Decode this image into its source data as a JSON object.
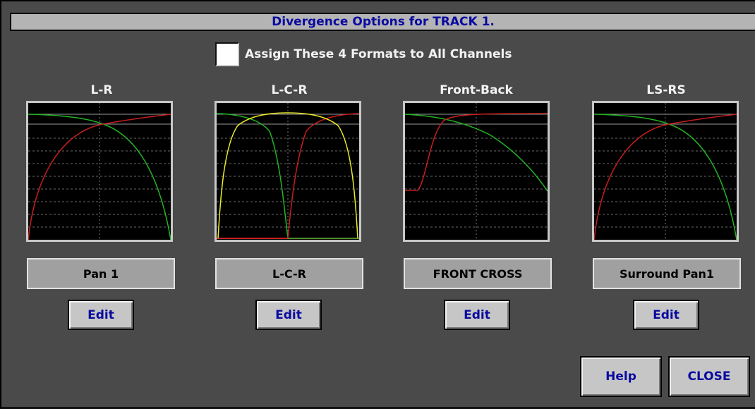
{
  "dialog": {
    "title": "Divergence Options for TRACK 1.",
    "assign_label": "Assign These 4 Formats to All Channels",
    "assign_checked": false
  },
  "panels": [
    {
      "title": "L-R",
      "format": "Pan 1",
      "edit_label": "Edit"
    },
    {
      "title": "L-C-R",
      "format": "L-C-R",
      "edit_label": "Edit"
    },
    {
      "title": "Front-Back",
      "format": "FRONT CROSS",
      "edit_label": "Edit"
    },
    {
      "title": "LS-RS",
      "format": "Surround Pan1",
      "edit_label": "Edit"
    }
  ],
  "buttons": {
    "help": "Help",
    "close": "CLOSE"
  },
  "colors": {
    "dialog_bg": "#4a4a4a",
    "title_text": "#0a0aa0",
    "curve_red": "#c81e1e",
    "curve_green": "#23b423",
    "curve_yellow": "#ecec2a",
    "grid": "#7a7a7a"
  }
}
